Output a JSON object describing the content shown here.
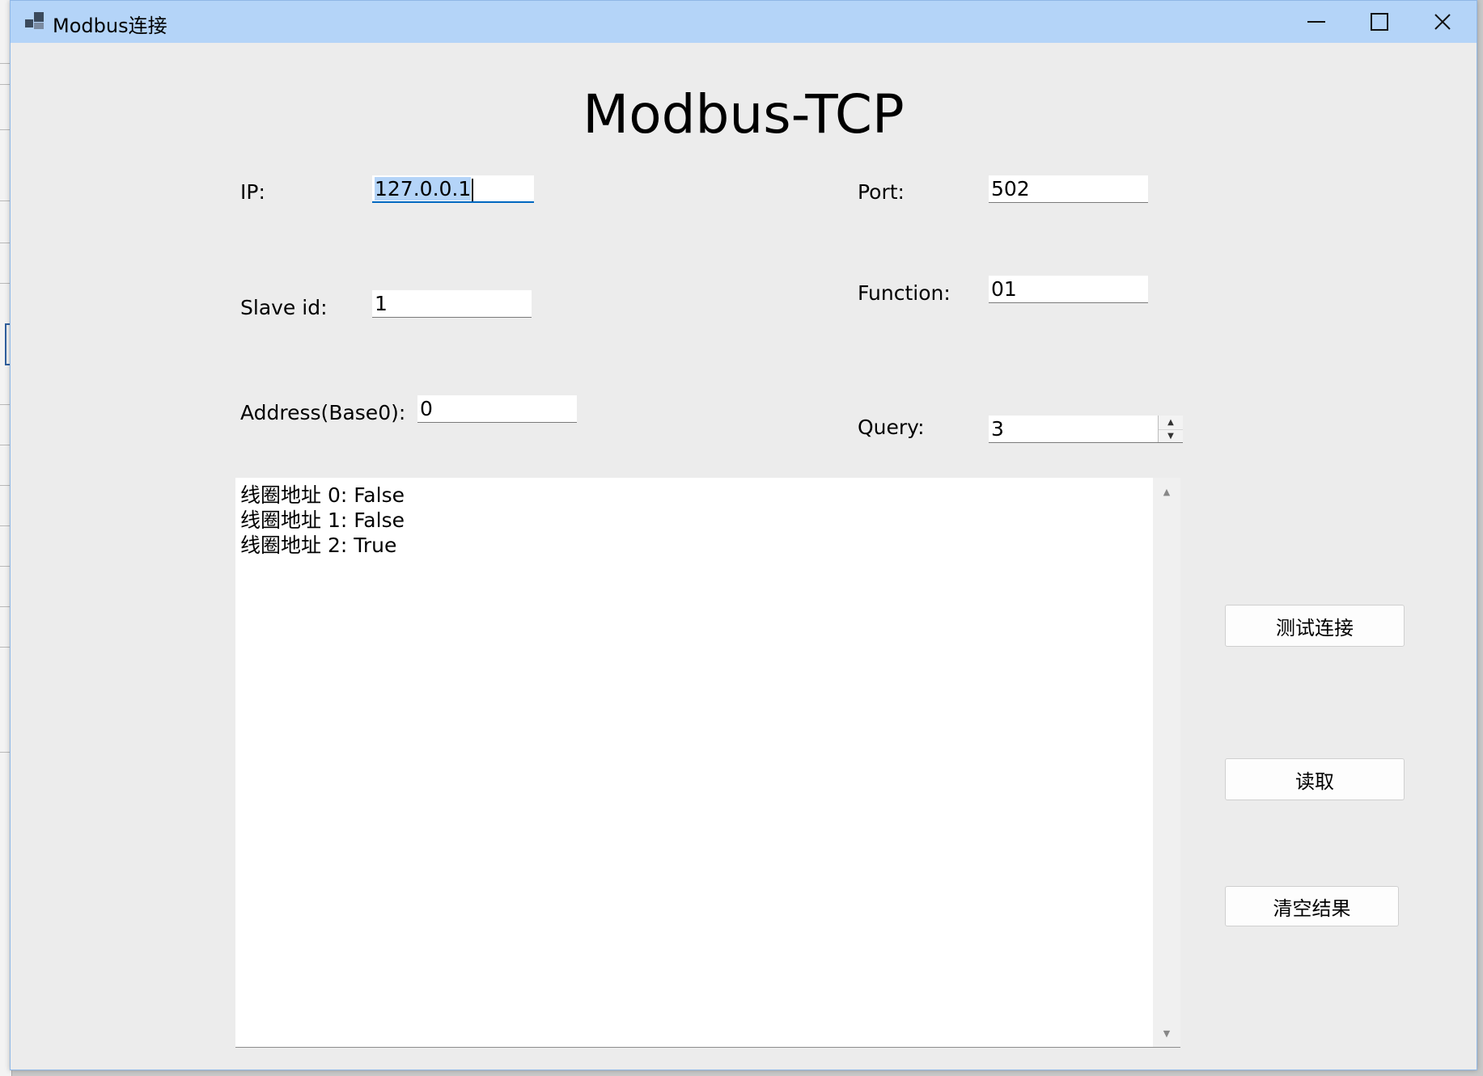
{
  "window": {
    "title": "Modbus连接",
    "controls": {
      "minimize": "minimize",
      "maximize": "maximize",
      "close": "close"
    }
  },
  "form": {
    "heading": "Modbus-TCP",
    "ip": {
      "label": "IP:",
      "value": "127.0.0.1"
    },
    "port": {
      "label": "Port:",
      "value": "502"
    },
    "slave_id": {
      "label": "Slave id:",
      "value": "1"
    },
    "function": {
      "label": "Function:",
      "value": "01"
    },
    "address": {
      "label": "Address(Base0):",
      "value": "0"
    },
    "query": {
      "label": "Query:",
      "value": "3"
    }
  },
  "output": {
    "lines": [
      "线圈地址 0: False",
      "线圈地址 1: False",
      "线圈地址 2: True"
    ]
  },
  "buttons": {
    "test_connection": "测试连接",
    "read": "读取",
    "clear_results": "清空结果"
  },
  "icons": {
    "app": "app-window-icon",
    "spin_up": "up-arrow-icon",
    "spin_down": "down-arrow-icon"
  },
  "colors": {
    "titlebar": "#b4d4f8",
    "window_bg": "#ececec",
    "focus_accent": "#0067c0",
    "selection": "#b4d4f8"
  }
}
